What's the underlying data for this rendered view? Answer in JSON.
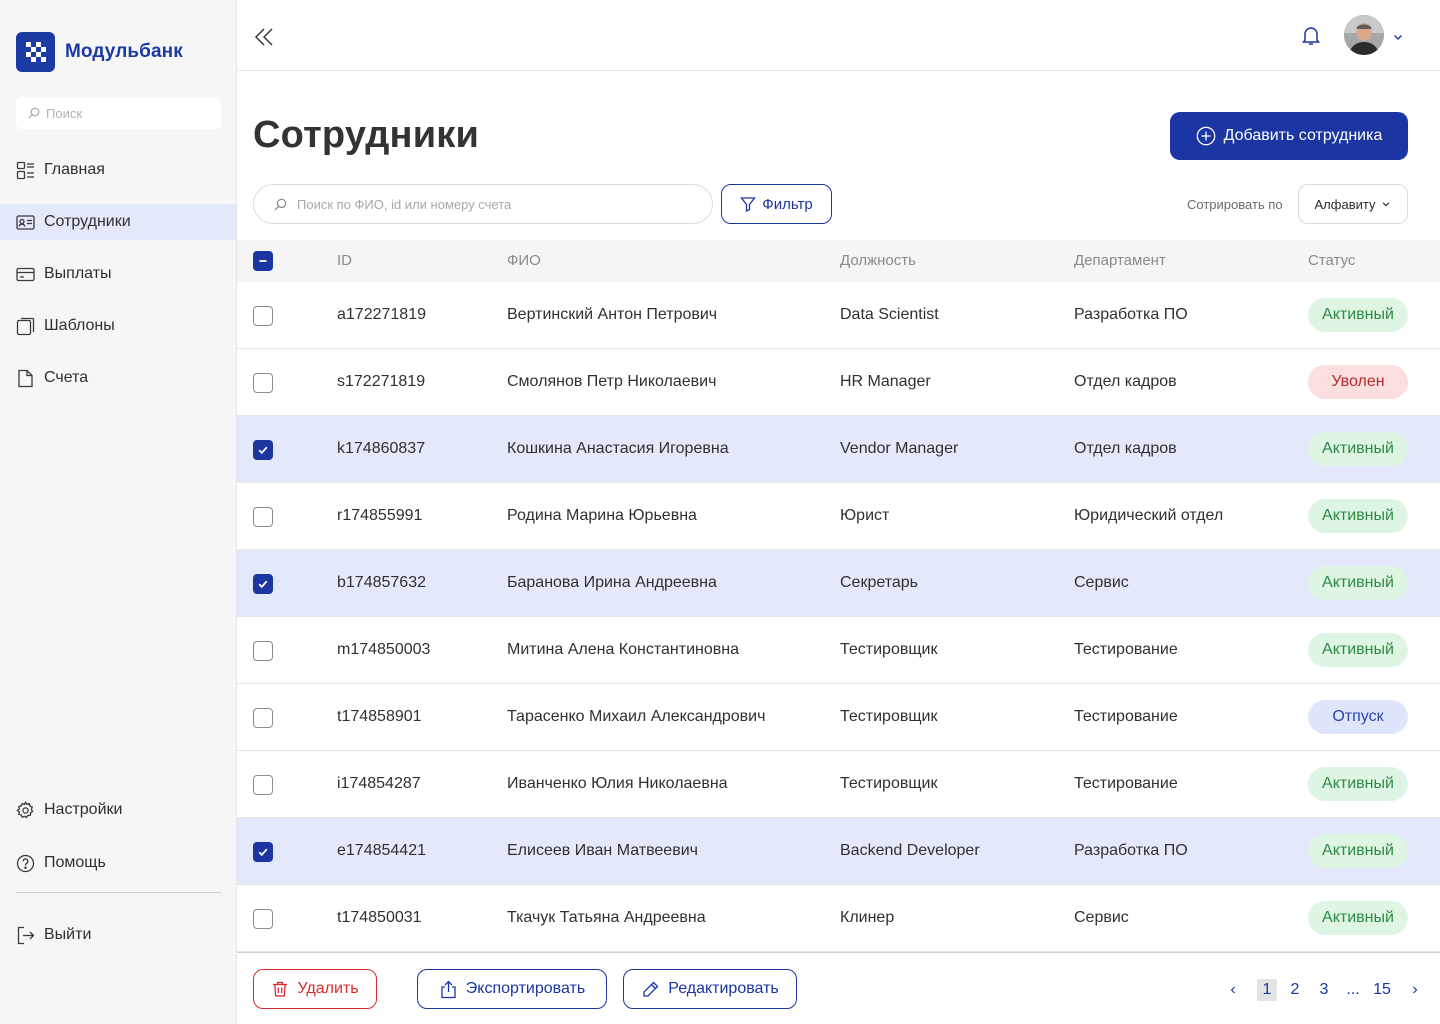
{
  "brand": {
    "name": "Модульбанк"
  },
  "sidebar": {
    "search_placeholder": "Поиск",
    "items": [
      {
        "label": "Главная",
        "icon": "home-icon",
        "active": false
      },
      {
        "label": "Сотрудники",
        "icon": "employees-icon",
        "active": true
      },
      {
        "label": "Выплаты",
        "icon": "card-icon",
        "active": false
      },
      {
        "label": "Шаблоны",
        "icon": "templates-icon",
        "active": false
      },
      {
        "label": "Счета",
        "icon": "document-icon",
        "active": false
      }
    ],
    "bottom_items": [
      {
        "label": "Настройки",
        "icon": "gear-icon"
      },
      {
        "label": "Помощь",
        "icon": "help-icon"
      }
    ],
    "logout_label": "Выйти"
  },
  "page": {
    "title": "Сотрудники",
    "add_button": "Добавить сотрудника",
    "search_placeholder": "Поиск по ФИО, id или номеру счета",
    "filter_button": "Фильтр",
    "sort_label": "Сотрировать по",
    "sort_value": "Алфавиту"
  },
  "table": {
    "columns": [
      "ID",
      "ФИО",
      "Должность",
      "Департамент",
      "Статус"
    ],
    "rows": [
      {
        "checked": false,
        "id": "a172271819",
        "name": "Вертинский Антон Петрович",
        "position": "Data Scientist",
        "department": "Разработка ПО",
        "status": "Активный",
        "status_type": "active"
      },
      {
        "checked": false,
        "id": "s172271819",
        "name": "Смолянов Петр Николаевич",
        "position": "HR Manager",
        "department": "Отдел кадров",
        "status": "Уволен",
        "status_type": "fired"
      },
      {
        "checked": true,
        "id": "k174860837",
        "name": "Кошкина Анастасия Игоревна",
        "position": "Vendor Manager",
        "department": "Отдел кадров",
        "status": "Активный",
        "status_type": "active"
      },
      {
        "checked": false,
        "id": "r174855991",
        "name": "Родина Марина Юрьевна",
        "position": "Юрист",
        "department": "Юридический отдел",
        "status": "Активный",
        "status_type": "active"
      },
      {
        "checked": true,
        "id": "b174857632",
        "name": "Баранова Ирина Андреевна",
        "position": "Секретарь",
        "department": "Сервис",
        "status": "Активный",
        "status_type": "active"
      },
      {
        "checked": false,
        "id": "m174850003",
        "name": "Митина Алена Константиновна",
        "position": "Тестировщик",
        "department": "Тестирование",
        "status": "Активный",
        "status_type": "active"
      },
      {
        "checked": false,
        "id": "t174858901",
        "name": "Тарасенко Михаил Александрович",
        "position": "Тестировщик",
        "department": "Тестирование",
        "status": "Отпуск",
        "status_type": "vacation"
      },
      {
        "checked": false,
        "id": "i174854287",
        "name": "Иванченко Юлия Николаевна",
        "position": "Тестировщик",
        "department": "Тестирование",
        "status": "Активный",
        "status_type": "active"
      },
      {
        "checked": true,
        "id": "e174854421",
        "name": "Елисеев Иван Матвеевич",
        "position": "Backend Developer",
        "department": "Разработка ПО",
        "status": "Активный",
        "status_type": "active"
      },
      {
        "checked": false,
        "id": "t174850031",
        "name": "Ткачук Татьяна Андреевна",
        "position": "Клинер",
        "department": "Сервис",
        "status": "Активный",
        "status_type": "active"
      }
    ]
  },
  "actions": {
    "delete": "Удалить",
    "export": "Экспортировать",
    "edit": "Редактировать"
  },
  "pagination": {
    "prev": "‹",
    "pages": [
      "1",
      "2",
      "3"
    ],
    "ellipsis": "...",
    "last": "15",
    "next": "›",
    "current": "1"
  },
  "colors": {
    "brand": "#1b36a3",
    "active_badge_bg": "#dff5e4",
    "fired_badge_bg": "#fbdede",
    "vacation_badge_bg": "#dfe5fb",
    "selected_row": "#e4e8fb",
    "danger": "#d92c2c"
  }
}
